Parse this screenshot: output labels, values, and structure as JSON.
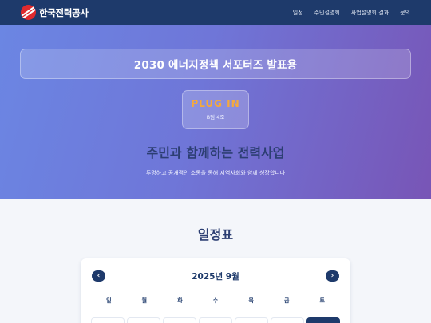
{
  "nav": {
    "brand": "한국전력공사",
    "items": [
      "일정",
      "주민설명회",
      "사업설명회 결과",
      "문의"
    ]
  },
  "hero": {
    "banner": "2030 에너지정책 서포터즈 발표용",
    "badge_title": "PLUG IN",
    "badge_sub": "B팀 4조",
    "heading": "주민과 함께하는 전력사업",
    "subheading": "투명하고 공개적인 소통을 통해 지역사회와 함께 성장합니다"
  },
  "schedule": {
    "title": "일정표",
    "month": "2025년 9월",
    "prev_icon": "chevron-left-icon",
    "next_icon": "chevron-right-icon",
    "weekdays": [
      "일",
      "월",
      "화",
      "수",
      "목",
      "금",
      "토"
    ]
  },
  "colors": {
    "nav_bg": "#1e3a6b",
    "accent_orange": "#f6a93a",
    "logo_red": "#e02a2e"
  }
}
